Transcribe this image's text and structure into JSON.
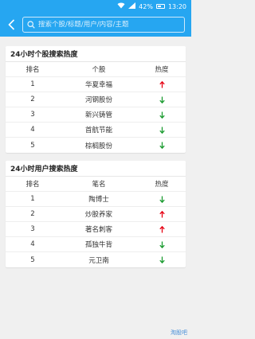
{
  "status": {
    "battery": "42%",
    "time": "13:20"
  },
  "search": {
    "placeholder": "搜索个股/标题/用户/内容/主题"
  },
  "colors": {
    "up": "#e60012",
    "down": "#1a9b2f",
    "brand": "#26a6f1"
  },
  "stocks": {
    "title": "24小时个股搜索热度",
    "headers": [
      "排名",
      "个股",
      "热度"
    ],
    "rows": [
      {
        "rank": "1",
        "name": "华夏幸福",
        "trend": "up"
      },
      {
        "rank": "2",
        "name": "河钢股份",
        "trend": "down"
      },
      {
        "rank": "3",
        "name": "新兴铸管",
        "trend": "down"
      },
      {
        "rank": "4",
        "name": "首航节能",
        "trend": "down"
      },
      {
        "rank": "5",
        "name": "棕榈股份",
        "trend": "down"
      }
    ]
  },
  "users": {
    "title": "24小时用户搜索热度",
    "headers": [
      "排名",
      "笔名",
      "热度"
    ],
    "rows": [
      {
        "rank": "1",
        "name": "陶博士",
        "trend": "down"
      },
      {
        "rank": "2",
        "name": "炒股养家",
        "trend": "up"
      },
      {
        "rank": "3",
        "name": "著名刺客",
        "trend": "up"
      },
      {
        "rank": "4",
        "name": "孤独牛背",
        "trend": "down"
      },
      {
        "rank": "5",
        "name": "元卫南",
        "trend": "down"
      }
    ]
  },
  "watermark": "淘股吧"
}
